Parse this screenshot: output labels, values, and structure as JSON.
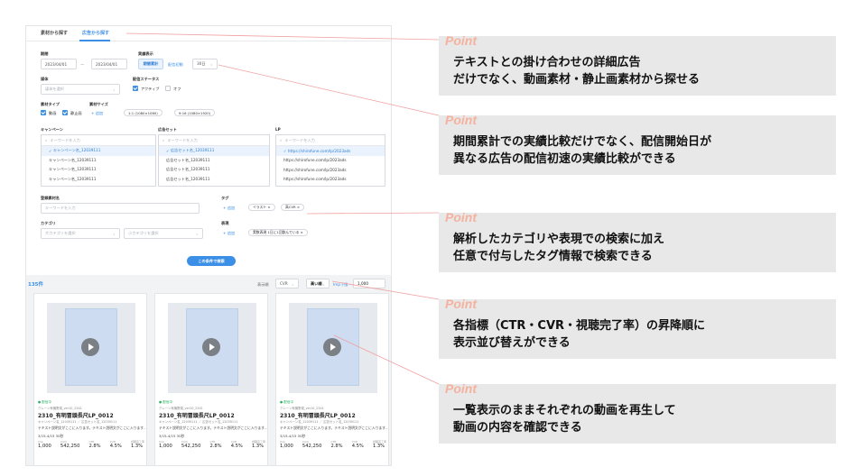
{
  "tabs": [
    "素材から探す",
    "広告から探す"
  ],
  "period": {
    "label": "期間",
    "start": "2023/04/01",
    "sep": "〜",
    "end": "2023/04/01"
  },
  "display": {
    "label": "実績表示",
    "mode_cumulative": "期間累計",
    "mode_initial": "配信初動",
    "days": "30日"
  },
  "channel": {
    "label": "媒体",
    "placeholder": "媒体を選択"
  },
  "delivery_status": {
    "label": "配信ステータス",
    "active": "アクティブ",
    "off": "オフ"
  },
  "material_type": {
    "label": "素材タイプ",
    "video": "動画",
    "still": "静止画"
  },
  "material_size": {
    "label": "素材サイズ",
    "add": "+ 追加",
    "size1": "1:1 (1080×1080)",
    "size2": "9:16 (1080×1920)"
  },
  "campaign": {
    "label": "キャンペーン",
    "search": "キーワードを入力",
    "items": [
      "キャンペーン名_12039111",
      "キャンペーン名_12039111",
      "キャンペーン名_12039111",
      "キャンペーン名_12039111"
    ]
  },
  "adset": {
    "label": "広告セット",
    "search": "キーワードを入力",
    "items": [
      "広告セット名_12039111",
      "広告セット名_12039111",
      "広告セット名_12039111",
      "広告セット名_12039111"
    ]
  },
  "lp": {
    "label": "LP",
    "search": "キーワードを入力",
    "items": [
      "https://shirofune.com/lp/2023ads",
      "https://shirofune.com/lp/2023ads",
      "https://shirofune.com/lp/2023ads",
      "https://shirofune.com/lp/2023ads"
    ]
  },
  "material_name": {
    "label": "登録素材名",
    "placeholder": "キーワードを入力"
  },
  "tag": {
    "label": "タグ",
    "add": "+ 追加",
    "chips": [
      "イラスト ×",
      "高CVR ×"
    ]
  },
  "category": {
    "label": "カテゴリ",
    "large": "大カテゴリを選択",
    "small": "小カテゴリを選択"
  },
  "expression": {
    "label": "表現",
    "add": "+ 追加",
    "chips": [
      "実数表現 1日に1回飲んでいる ×"
    ]
  },
  "search_button": "この条件で検索",
  "results": {
    "count": "135件",
    "sort_label": "表示順",
    "sort_metric": "CVR",
    "sort_order": "高い順",
    "imp_label": "Imp下限",
    "imp_value": "1,000"
  },
  "cards": [
    {
      "status": "● 配信中",
      "sub": "クレーン有機野菜_ver10_2341",
      "title": "2310_有明冒頭長尺LP_0012",
      "meta": "キャンペーン名_12039111 ／ 広告セット名_12039111",
      "desc": "テキスト説明文がここに入ります。テキスト説明文がここに入ります…",
      "date": "3/15-4/15",
      "duration": "30秒",
      "stats": [
        {
          "k": "Imp",
          "v": "1,000"
        },
        {
          "k": "Click",
          "v": "542,250"
        },
        {
          "k": "CTR",
          "v": "2.8%"
        },
        {
          "k": "CVR",
          "v": "4.5%"
        },
        {
          "k": "視聴完了率",
          "v": "1.3%"
        }
      ]
    },
    {
      "status": "● 配信中",
      "sub": "クレーン有機野菜_ver10_2341",
      "title": "2310_有明冒頭長尺LP_0012",
      "meta": "キャンペーン名_12039111 ／ 広告セット名_12039111",
      "desc": "テキスト説明文がここに入ります。テキスト説明文がここに入ります…",
      "date": "3/15-4/15",
      "duration": "30秒",
      "stats": [
        {
          "k": "Imp",
          "v": "1,000"
        },
        {
          "k": "Click",
          "v": "542,250"
        },
        {
          "k": "CTR",
          "v": "2.8%"
        },
        {
          "k": "CVR",
          "v": "4.5%"
        },
        {
          "k": "視聴完了率",
          "v": "1.3%"
        }
      ]
    },
    {
      "status": "● 配信中",
      "sub": "クレーン有機野菜_ver10_2341",
      "title": "2310_有明冒頭長尺LP_0012",
      "meta": "キャンペーン名_12039111 ／ 広告セット名_12039111",
      "desc": "テキスト説明文がここに入ります。テキスト説明文がここに入ります…",
      "date": "3/15-4/15",
      "duration": "30秒",
      "stats": [
        {
          "k": "Imp",
          "v": "1,000"
        },
        {
          "k": "Click",
          "v": "542,250"
        },
        {
          "k": "CTR",
          "v": "2.8%"
        },
        {
          "k": "CVR",
          "v": "4.5%"
        },
        {
          "k": "視聴完了率",
          "v": "1.3%"
        }
      ]
    }
  ],
  "callouts": [
    {
      "point": "Point",
      "line1": "テキストとの掛け合わせの詳細広告",
      "line2": "だけでなく、動画素材・静止画素材から探せる"
    },
    {
      "point": "Point",
      "line1": "期間累計での実績比較だけでなく、配信開始日が",
      "line2": "異なる広告の配信初速の実績比較ができる"
    },
    {
      "point": "Point",
      "line1": "解析したカテゴリや表現での検索に加え",
      "line2": "任意で付与したタグ情報で検索できる"
    },
    {
      "point": "Point",
      "line1": "各指標（CTR・CVR・視聴完了率）の昇降順に",
      "line2": "表示並び替えができる"
    },
    {
      "point": "Point",
      "line1": "一覧表示のままそれぞれの動画を再生して",
      "line2": "動画の内容を確認できる"
    }
  ],
  "colors": {
    "accent": "#3b8fe6",
    "point": "#f4b29e",
    "callout_bg": "#e8e8e8",
    "leader": "#f0a0a0"
  }
}
